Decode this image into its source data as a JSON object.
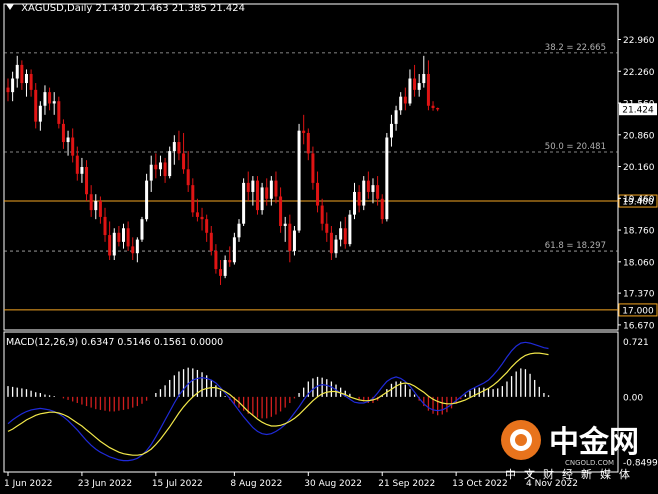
{
  "colors": {
    "background": "#000000",
    "bull_candle": "#ffffff",
    "bear_candle": "#e01414",
    "fib_line": "#b0b0b0",
    "sr_line": "#f5a623",
    "price_marker_bg": "#ffffff",
    "macd_line": "#1f2ad8",
    "signal_line": "#f2e84a",
    "hist_positive": "#ffffff",
    "hist_negative": "#d21e1e",
    "axis_text": "#ffffff",
    "axis_border": "#ffffff"
  },
  "watermark": {
    "brand": "中金网",
    "domain": "CNGOLD.COM",
    "subtitle": "中文财经新媒体"
  },
  "chart_data": [
    {
      "type": "candlestick",
      "title": "XAGUSD,Daily  21.430 21.463 21.385 21.424",
      "ylim": [
        16.8,
        23.5
      ],
      "y_ticks": [
        "22.960",
        "22.260",
        "21.560",
        "20.860",
        "20.160",
        "19.460",
        "18.760",
        "18.060",
        "17.370",
        "16.670"
      ],
      "price_label": "21.424",
      "horizontal_levels": [
        {
          "name": "fib-38.2",
          "value": 22.665,
          "label": "38.2 = 22.665",
          "style": "dashed"
        },
        {
          "name": "fib-50.0",
          "value": 20.481,
          "label": "50.0 = 20.481",
          "style": "dashed"
        },
        {
          "name": "fib-61.8",
          "value": 18.297,
          "label": "61.8 = 18.297",
          "style": "dashed"
        },
        {
          "name": "level-19400",
          "value": 19.4,
          "label": "19.400",
          "style": "solid"
        },
        {
          "name": "level-17000",
          "value": 17.0,
          "label": "17.000",
          "style": "solid"
        }
      ],
      "x_tick_labels": [
        "1 Jun 2022",
        "23 Jun 2022",
        "15 Jul 2022",
        "8 Aug 2022",
        "30 Aug 2022",
        "21 Sep 2022",
        "13 Oct 2022",
        "4 Nov 2022"
      ],
      "x_tick_bar_index": [
        0,
        16,
        32,
        49,
        65,
        81,
        97,
        113
      ],
      "candles": [
        [
          21.9,
          22.1,
          21.6,
          21.8
        ],
        [
          21.8,
          22.25,
          21.6,
          22.1
        ],
        [
          22.1,
          22.6,
          21.9,
          22.4
        ],
        [
          22.4,
          22.5,
          21.85,
          22.0
        ],
        [
          22.0,
          22.3,
          21.7,
          22.2
        ],
        [
          22.2,
          22.3,
          21.7,
          21.85
        ],
        [
          21.85,
          22.0,
          21.0,
          21.15
        ],
        [
          21.15,
          21.6,
          20.95,
          21.5
        ],
        [
          21.5,
          21.95,
          21.3,
          21.8
        ],
        [
          21.8,
          21.9,
          21.4,
          21.55
        ],
        [
          21.55,
          21.8,
          21.3,
          21.6
        ],
        [
          21.6,
          21.7,
          21.0,
          21.1
        ],
        [
          21.1,
          21.2,
          20.55,
          20.7
        ],
        [
          20.7,
          20.95,
          20.4,
          20.8
        ],
        [
          20.8,
          21.0,
          20.25,
          20.4
        ],
        [
          20.4,
          20.6,
          19.85,
          20.0
        ],
        [
          20.0,
          20.35,
          19.8,
          20.15
        ],
        [
          20.15,
          20.3,
          19.4,
          19.55
        ],
        [
          19.55,
          19.75,
          19.05,
          19.2
        ],
        [
          19.2,
          19.55,
          19.0,
          19.4
        ],
        [
          19.4,
          19.5,
          18.9,
          19.05
        ],
        [
          19.05,
          19.25,
          18.5,
          18.65
        ],
        [
          18.65,
          18.95,
          18.1,
          18.2
        ],
        [
          18.2,
          18.8,
          18.1,
          18.7
        ],
        [
          18.7,
          18.85,
          18.4,
          18.5
        ],
        [
          18.5,
          18.9,
          18.35,
          18.8
        ],
        [
          18.8,
          18.95,
          18.3,
          18.4
        ],
        [
          18.4,
          18.6,
          18.1,
          18.25
        ],
        [
          18.25,
          18.6,
          18.05,
          18.55
        ],
        [
          18.55,
          19.05,
          18.5,
          19.0
        ],
        [
          19.0,
          20.0,
          18.95,
          19.85
        ],
        [
          19.85,
          20.4,
          19.6,
          20.2
        ],
        [
          20.2,
          20.45,
          19.9,
          20.1
        ],
        [
          20.1,
          20.4,
          19.95,
          20.25
        ],
        [
          20.25,
          20.35,
          19.8,
          19.95
        ],
        [
          19.95,
          20.6,
          19.9,
          20.5
        ],
        [
          20.5,
          20.85,
          20.2,
          20.7
        ],
        [
          20.7,
          20.95,
          20.3,
          20.45
        ],
        [
          20.45,
          20.9,
          20.0,
          20.1
        ],
        [
          20.1,
          20.5,
          19.6,
          19.75
        ],
        [
          19.75,
          19.9,
          19.05,
          19.15
        ],
        [
          19.15,
          19.45,
          18.95,
          19.05
        ],
        [
          19.05,
          19.25,
          18.75,
          19.0
        ],
        [
          19.0,
          19.1,
          18.5,
          18.7
        ],
        [
          18.7,
          18.85,
          18.2,
          18.3
        ],
        [
          18.3,
          18.45,
          17.8,
          17.9
        ],
        [
          17.9,
          18.1,
          17.55,
          17.75
        ],
        [
          17.75,
          18.2,
          17.7,
          18.1
        ],
        [
          18.1,
          18.4,
          17.95,
          18.05
        ],
        [
          18.05,
          18.7,
          18.0,
          18.6
        ],
        [
          18.6,
          19.0,
          18.5,
          18.9
        ],
        [
          18.9,
          19.9,
          18.85,
          19.8
        ],
        [
          19.8,
          20.05,
          19.4,
          19.6
        ],
        [
          19.6,
          19.95,
          19.3,
          19.85
        ],
        [
          19.85,
          19.95,
          19.1,
          19.2
        ],
        [
          19.2,
          19.8,
          19.1,
          19.7
        ],
        [
          19.7,
          19.9,
          19.3,
          19.45
        ],
        [
          19.45,
          19.95,
          19.3,
          19.85
        ],
        [
          19.85,
          20.05,
          19.35,
          19.5
        ],
        [
          19.5,
          19.7,
          18.7,
          18.85
        ],
        [
          18.85,
          19.05,
          18.5,
          18.9
        ],
        [
          18.9,
          19.1,
          18.05,
          18.3
        ],
        [
          18.3,
          18.85,
          18.2,
          18.75
        ],
        [
          18.75,
          21.1,
          18.7,
          20.95
        ],
        [
          20.95,
          21.3,
          20.65,
          20.9
        ],
        [
          20.9,
          21.0,
          20.3,
          20.45
        ],
        [
          20.45,
          20.6,
          19.65,
          19.8
        ],
        [
          19.8,
          20.05,
          19.15,
          19.3
        ],
        [
          19.3,
          19.45,
          18.75,
          18.9
        ],
        [
          18.9,
          19.15,
          18.5,
          18.7
        ],
        [
          18.7,
          18.85,
          18.1,
          18.25
        ],
        [
          18.25,
          18.65,
          18.15,
          18.55
        ],
        [
          18.55,
          18.95,
          18.4,
          18.8
        ],
        [
          18.8,
          19.05,
          18.35,
          18.45
        ],
        [
          18.45,
          19.2,
          18.4,
          19.1
        ],
        [
          19.1,
          19.8,
          19.0,
          19.6
        ],
        [
          19.6,
          19.75,
          19.15,
          19.3
        ],
        [
          19.3,
          19.95,
          19.2,
          19.85
        ],
        [
          19.85,
          20.05,
          19.45,
          19.6
        ],
        [
          19.6,
          19.9,
          19.35,
          19.75
        ],
        [
          19.75,
          19.95,
          19.3,
          19.45
        ],
        [
          19.45,
          19.55,
          18.9,
          19.0
        ],
        [
          19.0,
          20.9,
          18.95,
          20.8
        ],
        [
          20.8,
          21.3,
          20.6,
          21.1
        ],
        [
          21.1,
          21.5,
          20.95,
          21.4
        ],
        [
          21.4,
          21.8,
          21.3,
          21.7
        ],
        [
          21.7,
          21.9,
          21.4,
          21.55
        ],
        [
          21.55,
          22.3,
          21.5,
          22.1
        ],
        [
          22.1,
          22.4,
          21.7,
          21.85
        ],
        [
          21.85,
          22.2,
          21.7,
          22.0
        ],
        [
          22.0,
          22.6,
          21.9,
          22.2
        ],
        [
          22.2,
          22.5,
          21.4,
          21.5
        ],
        [
          21.5,
          21.6,
          21.39,
          21.45
        ],
        [
          21.45,
          21.46,
          21.38,
          21.42
        ]
      ]
    },
    {
      "type": "histogram-line",
      "title": "MACD(12,26,9) 0.6347 0.5146 0.1561 0.0000",
      "ylim": [
        -0.9,
        0.74
      ],
      "y_ticks": [
        "0.721",
        "0.00",
        "-0.8499"
      ],
      "histogram": [
        0.14,
        0.13,
        0.12,
        0.11,
        0.1,
        0.08,
        0.06,
        0.05,
        0.03,
        0.02,
        0.01,
        0.0,
        -0.02,
        -0.04,
        -0.06,
        -0.08,
        -0.1,
        -0.12,
        -0.14,
        -0.16,
        -0.17,
        -0.18,
        -0.19,
        -0.19,
        -0.18,
        -0.17,
        -0.16,
        -0.14,
        -0.12,
        -0.09,
        -0.05,
        0.0,
        0.05,
        0.1,
        0.15,
        0.22,
        0.28,
        0.33,
        0.36,
        0.38,
        0.37,
        0.35,
        0.32,
        0.28,
        0.22,
        0.15,
        0.08,
        0.01,
        -0.04,
        -0.09,
        -0.14,
        -0.18,
        -0.22,
        -0.25,
        -0.27,
        -0.28,
        -0.28,
        -0.26,
        -0.23,
        -0.19,
        -0.14,
        -0.08,
        -0.02,
        0.05,
        0.12,
        0.2,
        0.24,
        0.26,
        0.25,
        0.23,
        0.2,
        0.16,
        0.12,
        0.08,
        0.04,
        0.0,
        -0.03,
        -0.06,
        -0.08,
        -0.08,
        -0.05,
        0.02,
        0.1,
        0.17,
        0.2,
        0.2,
        0.16,
        0.1,
        0.03,
        -0.05,
        -0.12,
        -0.18,
        -0.22,
        -0.24,
        -0.23,
        -0.2,
        -0.15,
        -0.09,
        -0.03,
        0.03,
        0.08,
        0.11,
        0.12,
        0.12,
        0.11,
        0.1,
        0.11,
        0.14,
        0.2,
        0.27,
        0.33,
        0.37,
        0.36,
        0.3,
        0.22,
        0.13,
        0.05,
        0.02
      ],
      "macd": [
        -0.35,
        -0.3,
        -0.26,
        -0.22,
        -0.19,
        -0.17,
        -0.16,
        -0.15,
        -0.16,
        -0.17,
        -0.19,
        -0.22,
        -0.26,
        -0.31,
        -0.37,
        -0.43,
        -0.5,
        -0.57,
        -0.63,
        -0.68,
        -0.72,
        -0.75,
        -0.78,
        -0.8,
        -0.82,
        -0.83,
        -0.83,
        -0.82,
        -0.8,
        -0.76,
        -0.7,
        -0.62,
        -0.52,
        -0.41,
        -0.3,
        -0.19,
        -0.08,
        0.02,
        0.1,
        0.17,
        0.22,
        0.24,
        0.25,
        0.24,
        0.22,
        0.18,
        0.12,
        0.05,
        -0.02,
        -0.1,
        -0.18,
        -0.26,
        -0.33,
        -0.4,
        -0.45,
        -0.48,
        -0.49,
        -0.48,
        -0.45,
        -0.41,
        -0.36,
        -0.29,
        -0.21,
        -0.13,
        -0.04,
        0.04,
        0.1,
        0.14,
        0.16,
        0.15,
        0.13,
        0.09,
        0.05,
        0.01,
        -0.03,
        -0.07,
        -0.08,
        -0.08,
        -0.06,
        -0.02,
        0.05,
        0.13,
        0.2,
        0.24,
        0.26,
        0.24,
        0.2,
        0.14,
        0.06,
        -0.02,
        -0.09,
        -0.14,
        -0.17,
        -0.18,
        -0.17,
        -0.14,
        -0.1,
        -0.05,
        0.0,
        0.05,
        0.09,
        0.12,
        0.15,
        0.18,
        0.22,
        0.28,
        0.35,
        0.43,
        0.52,
        0.6,
        0.66,
        0.7,
        0.71,
        0.7,
        0.68,
        0.66,
        0.64,
        0.63
      ],
      "signal": [
        -0.45,
        -0.42,
        -0.38,
        -0.34,
        -0.3,
        -0.27,
        -0.24,
        -0.22,
        -0.21,
        -0.2,
        -0.2,
        -0.21,
        -0.23,
        -0.26,
        -0.3,
        -0.34,
        -0.38,
        -0.43,
        -0.48,
        -0.53,
        -0.58,
        -0.62,
        -0.66,
        -0.69,
        -0.72,
        -0.74,
        -0.75,
        -0.76,
        -0.76,
        -0.75,
        -0.72,
        -0.68,
        -0.62,
        -0.55,
        -0.47,
        -0.39,
        -0.3,
        -0.21,
        -0.13,
        -0.06,
        0.0,
        0.05,
        0.09,
        0.11,
        0.12,
        0.12,
        0.1,
        0.07,
        0.03,
        -0.02,
        -0.07,
        -0.13,
        -0.19,
        -0.24,
        -0.29,
        -0.33,
        -0.36,
        -0.38,
        -0.38,
        -0.37,
        -0.35,
        -0.32,
        -0.28,
        -0.23,
        -0.17,
        -0.11,
        -0.05,
        0.0,
        0.04,
        0.06,
        0.07,
        0.07,
        0.05,
        0.03,
        0.0,
        -0.02,
        -0.04,
        -0.05,
        -0.05,
        -0.04,
        -0.02,
        0.02,
        0.06,
        0.1,
        0.14,
        0.17,
        0.18,
        0.17,
        0.14,
        0.1,
        0.06,
        0.01,
        -0.03,
        -0.06,
        -0.08,
        -0.09,
        -0.09,
        -0.08,
        -0.06,
        -0.04,
        -0.01,
        0.02,
        0.05,
        0.08,
        0.11,
        0.15,
        0.2,
        0.26,
        0.32,
        0.39,
        0.45,
        0.5,
        0.54,
        0.56,
        0.57,
        0.57,
        0.56,
        0.55
      ]
    }
  ]
}
